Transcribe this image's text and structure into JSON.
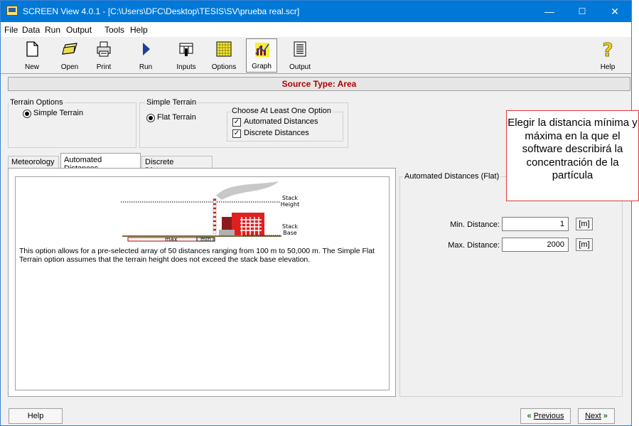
{
  "window": {
    "title": "SCREEN View 4.0.1 - [C:\\Users\\DFC\\Desktop\\TESIS\\SV\\prueba real.scr]",
    "controls": {
      "minimize": "—",
      "maximize": "☐",
      "close": "✕"
    }
  },
  "menu": [
    "File",
    "Data",
    "Run",
    "Output",
    "Tools",
    "Help"
  ],
  "toolbar": {
    "new": "New",
    "open": "Open",
    "print": "Print",
    "run": "Run",
    "inputs": "Inputs",
    "options": "Options",
    "graph": "Graph",
    "output": "Output",
    "help": "Help"
  },
  "source_type": "Source Type: Area",
  "terrain_options": {
    "title": "Terrain Options",
    "choice": "Simple Terrain"
  },
  "simple_terrain": {
    "title": "Simple Terrain",
    "choice": "Flat Terrain",
    "options_title": "Choose At Least One Option",
    "automated": "Automated Distances",
    "discrete": "Discrete Distances"
  },
  "tabs": [
    "Meteorology",
    "Automated Distances",
    "Discrete Distances"
  ],
  "diagram": {
    "stack_height": [
      "Stack",
      "Height"
    ],
    "stack_base": [
      "Stack",
      "Base"
    ],
    "max": "max",
    "min": "min"
  },
  "description": "This option allows for a pre-selected array of 50 distances ranging from 100 m to 50,000 m.  The Simple Flat Terrain option assumes that the terrain height does not exceed the stack base elevation.",
  "automated_group": {
    "title": "Automated Distances (Flat)",
    "min_label": "Min. Distance:",
    "min_value": "1",
    "max_label": "Max. Distance:",
    "max_value": "2000",
    "unit": "[m]"
  },
  "callout": "Elegir la distancia mínima  y máxima  en la que el software describirá la concentración  de la partícula",
  "bottom": {
    "help": "Help",
    "previous": "Previous",
    "next": "Next"
  }
}
